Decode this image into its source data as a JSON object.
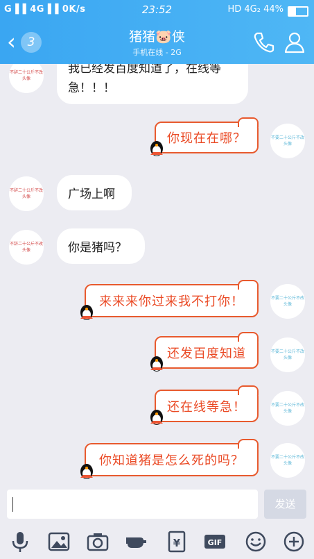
{
  "status_bar": {
    "left": "G▐▐ 4G▐▐ 0K/s",
    "time": "23:52",
    "right": "HD 4G₂ 44%",
    "battery_percent": 44
  },
  "header": {
    "back_count": "3",
    "contact_name": "猪猪🐷侠",
    "status": "手机在线 - 2G"
  },
  "messages": [
    {
      "side": "left",
      "text": "我已经发百度知道了，在线等急！！！",
      "avatar_text": "不辞二十公斤不改头像"
    },
    {
      "side": "right",
      "text": "你现在在哪？",
      "avatar_text": "不要二十公斤不改头像"
    },
    {
      "side": "left",
      "text": "广场上啊",
      "avatar_text": "不辞二十公斤不改头像"
    },
    {
      "side": "left",
      "text": "你是猪吗？",
      "avatar_text": "不辞二十公斤不改头像"
    },
    {
      "side": "right",
      "text": "来来来你过来我不打你！",
      "avatar_text": "不要二十公斤不改头像"
    },
    {
      "side": "right",
      "text": "还发百度知道",
      "avatar_text": "不要二十公斤不改头像"
    },
    {
      "side": "right",
      "text": "还在线等急！",
      "avatar_text": "不要二十公斤不改头像"
    },
    {
      "side": "right",
      "text": "你知道猪是怎么死的吗？",
      "avatar_text": "不要二十公斤不改头像"
    }
  ],
  "input": {
    "value": "",
    "send_label": "发送"
  },
  "toolbar": [
    "voice-icon",
    "image-icon",
    "camera-icon",
    "hand-icon",
    "red-packet-icon",
    "gif-icon",
    "emoji-icon",
    "plus-icon"
  ],
  "colors": {
    "header": "#3aa6f2",
    "bubble_border": "#e85a2e",
    "bubble_text": "#ea4a25"
  }
}
